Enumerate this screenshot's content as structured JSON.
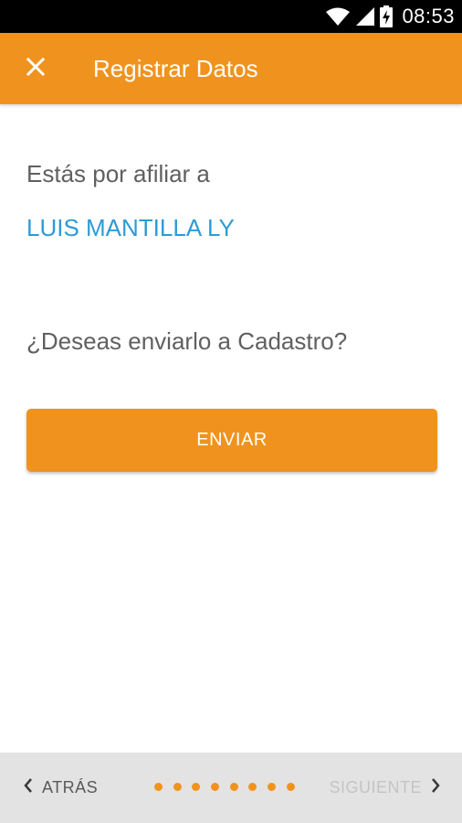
{
  "status_bar": {
    "time": "08:53",
    "icons": [
      "wifi-icon",
      "signal-icon",
      "battery-charging-icon"
    ]
  },
  "app_bar": {
    "title": "Registrar Datos",
    "close_icon": "close-icon"
  },
  "main": {
    "intro_text": "Estás por afiliar a",
    "person_name": "LUIS MANTILLA LY",
    "question": "¿Deseas enviarlo a Cadastro?",
    "send_button_label": "ENVIAR"
  },
  "bottom_nav": {
    "back_label": "ATRÁS",
    "next_label": "SIGUIENTE",
    "page_dots": 8
  },
  "colors": {
    "accent": "#f0931e",
    "name_blue": "#2d9bd6",
    "text_gray": "#606060",
    "nav_background": "#e3e3e3",
    "disabled_text": "#c4c4c4"
  }
}
